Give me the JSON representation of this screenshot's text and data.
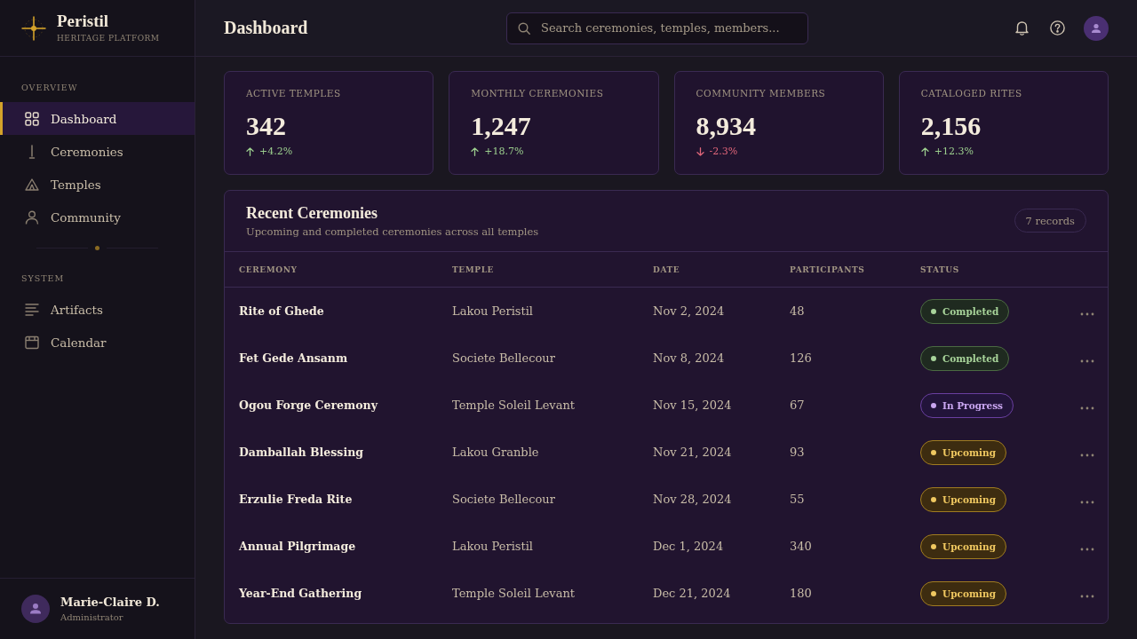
{
  "sidebar": {
    "brand": {
      "name": "Peristil",
      "tagline": "HERITAGE PLATFORM"
    },
    "sections": [
      {
        "label": "OVERVIEW",
        "items": [
          {
            "label": "Dashboard",
            "selected": true
          },
          {
            "label": "Ceremonies",
            "selected": false
          },
          {
            "label": "Temples",
            "selected": false
          },
          {
            "label": "Community",
            "selected": false
          }
        ]
      },
      {
        "label": "SYSTEM",
        "items": [
          {
            "label": "Artifacts",
            "selected": false
          },
          {
            "label": "Calendar",
            "selected": false
          }
        ]
      }
    ],
    "user": {
      "name": "Marie-Claire D.",
      "role": "Administrator"
    }
  },
  "header": {
    "title": "Dashboard",
    "search": {
      "placeholder": "Search ceremonies, temples, members..."
    }
  },
  "stats": [
    {
      "label": "ACTIVE TEMPLES",
      "value": "342",
      "change": "+4.2%",
      "rising": true
    },
    {
      "label": "MONTHLY CEREMONIES",
      "value": "1,247",
      "change": "+18.7%",
      "rising": true
    },
    {
      "label": "COMMUNITY MEMBERS",
      "value": "8,934",
      "change": "-2.3%",
      "rising": false
    },
    {
      "label": "CATALOGED RITES",
      "value": "2,156",
      "change": "+12.3%",
      "rising": true
    }
  ],
  "ceremonies": {
    "title": "Recent Ceremonies",
    "subtitle": "Upcoming and completed ceremonies across all temples",
    "count": "7 records",
    "columns": [
      "CEREMONY",
      "TEMPLE",
      "DATE",
      "PARTICIPANTS",
      "STATUS"
    ],
    "rows": [
      {
        "ceremony": "Rite of Ghede",
        "temple": "Lakou Peristil",
        "date": "Nov 2, 2024",
        "participants": "48",
        "status": {
          "label": "Completed",
          "kind": "completed"
        }
      },
      {
        "ceremony": "Fet Gede Ansanm",
        "temple": "Societe Bellecour",
        "date": "Nov 8, 2024",
        "participants": "126",
        "status": {
          "label": "Completed",
          "kind": "completed"
        }
      },
      {
        "ceremony": "Ogou Forge Ceremony",
        "temple": "Temple Soleil Levant",
        "date": "Nov 15, 2024",
        "participants": "67",
        "status": {
          "label": "In Progress",
          "kind": "in_progress"
        }
      },
      {
        "ceremony": "Damballah Blessing",
        "temple": "Lakou Granble",
        "date": "Nov 21, 2024",
        "participants": "93",
        "status": {
          "label": "Upcoming",
          "kind": "upcoming"
        }
      },
      {
        "ceremony": "Erzulie Freda Rite",
        "temple": "Societe Bellecour",
        "date": "Nov 28, 2024",
        "participants": "55",
        "status": {
          "label": "Upcoming",
          "kind": "upcoming"
        }
      },
      {
        "ceremony": "Annual Pilgrimage",
        "temple": "Lakou Peristil",
        "date": "Dec 1, 2024",
        "participants": "340",
        "status": {
          "label": "Upcoming",
          "kind": "upcoming"
        }
      },
      {
        "ceremony": "Year-End Gathering",
        "temple": "Temple Soleil Levant",
        "date": "Dec 21, 2024",
        "participants": "180",
        "status": {
          "label": "Upcoming",
          "kind": "upcoming"
        }
      }
    ]
  }
}
